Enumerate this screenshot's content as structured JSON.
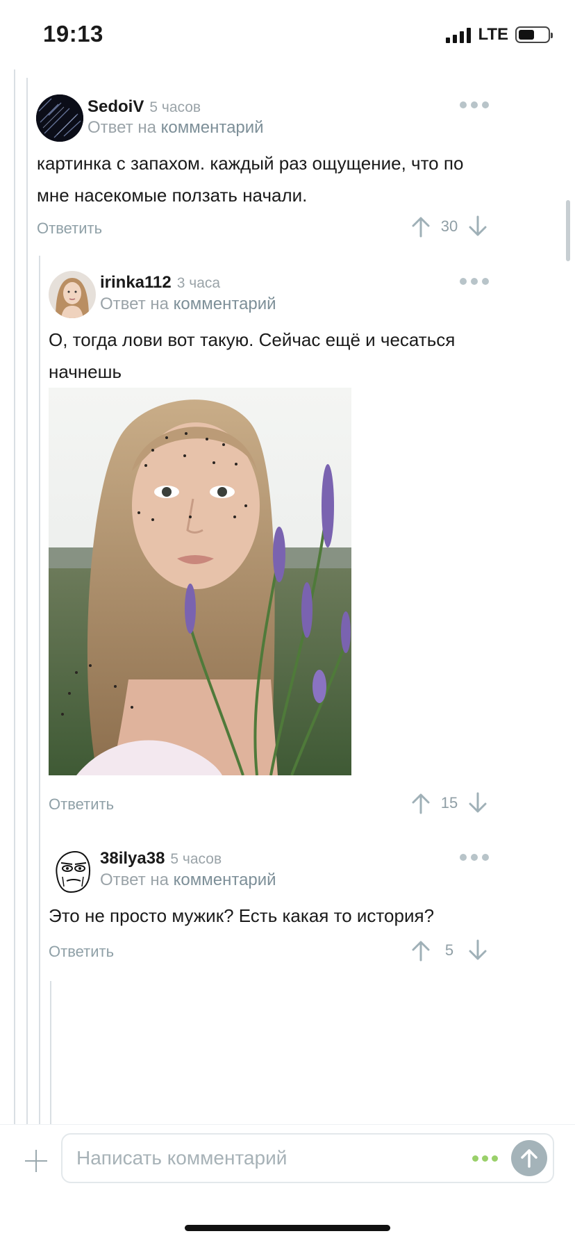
{
  "status_bar": {
    "time": "19:13",
    "network": "LTE"
  },
  "comments": [
    {
      "author": "SedoiV",
      "time": "5 часов",
      "reply_prefix": "Ответ на",
      "reply_link": "комментарий",
      "text_lines": [
        "картинка с запахом. каждый раз ощущение, что по",
        "мне насекомые ползать начали."
      ],
      "reply_label": "Ответить",
      "rating": "30",
      "avatar_icon": "dark-lines-avatar"
    },
    {
      "author": "irinka112",
      "time": "3 часа",
      "reply_prefix": "Ответ на",
      "reply_link": "комментарий",
      "text_lines": [
        "О, тогда лови вот такую. Сейчас ещё и чесаться",
        "начнешь"
      ],
      "reply_label": "Ответить",
      "rating": "15",
      "avatar_icon": "woman-portrait-avatar",
      "photo_icon": "woman-with-mosquitoes-and-lavender-photo"
    },
    {
      "author": "38ilya38",
      "time": "5 часов",
      "reply_prefix": "Ответ на",
      "reply_link": "комментарий",
      "text_lines": [
        "Это не просто мужик? Есть какая то история?"
      ],
      "reply_label": "Ответить",
      "rating": "5",
      "avatar_icon": "me-gusta-meme-avatar"
    }
  ],
  "composer": {
    "placeholder": "Написать комментарий"
  },
  "colors": {
    "accent_muted": "#8fa0a7",
    "thread_line": "#d9dfe3",
    "send_button": "#a4b3b9",
    "typing_dots": "#9ad06a"
  }
}
